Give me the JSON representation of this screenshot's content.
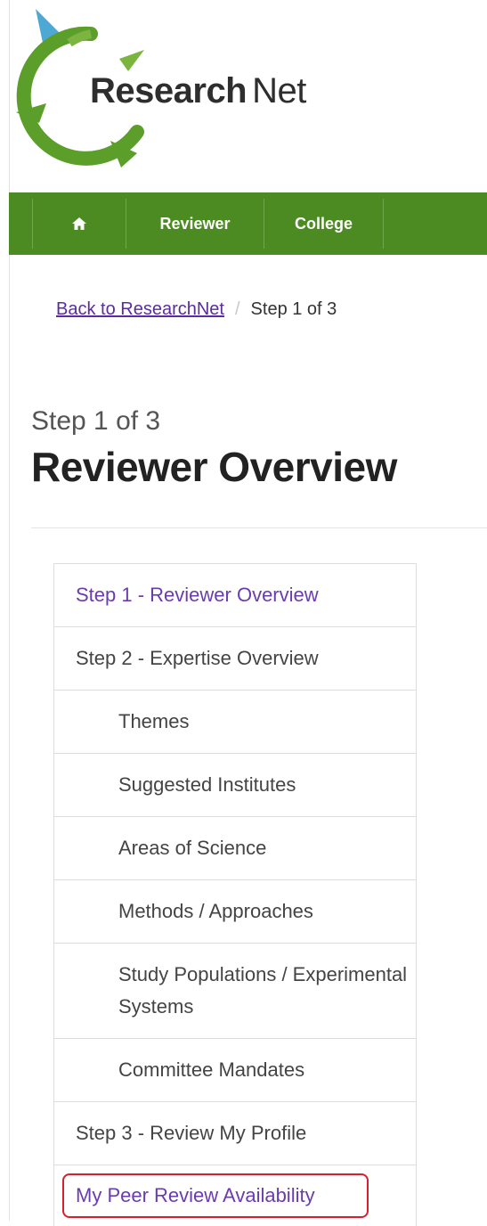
{
  "logo": {
    "part1": "Research",
    "part2": "Net"
  },
  "nav": {
    "home_icon": "home-icon",
    "items": [
      {
        "label": "Reviewer"
      },
      {
        "label": "College"
      }
    ],
    "color": "#4c8b22"
  },
  "breadcrumb": {
    "link": "Back to ResearchNet",
    "separator": "/",
    "current": "Step 1 of 3"
  },
  "heading": {
    "subtitle": "Step 1 of 3",
    "title": "Reviewer Overview"
  },
  "steps": [
    {
      "label": "Step 1 - Reviewer Overview"
    },
    {
      "label": "Step 2 - Expertise Overview"
    },
    {
      "label": "Themes"
    },
    {
      "label": "Suggested Institutes"
    },
    {
      "label": "Areas of Science"
    },
    {
      "label": "Methods / Approaches"
    },
    {
      "label": "Study Populations / Experimental Systems"
    },
    {
      "label": "Committee Mandates"
    },
    {
      "label": "Step 3 - Review My Profile"
    },
    {
      "label": "My Peer Review Availability"
    }
  ],
  "colors": {
    "link": "#5b2c9e",
    "active": "#6a3cae",
    "highlight_border": "#d5202e"
  }
}
